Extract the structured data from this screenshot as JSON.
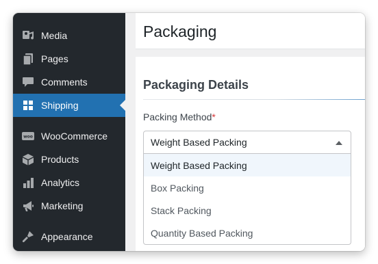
{
  "sidebar": {
    "items": [
      {
        "label": "Media",
        "icon": "media-icon",
        "active": false
      },
      {
        "label": "Pages",
        "icon": "pages-icon",
        "active": false
      },
      {
        "label": "Comments",
        "icon": "comments-icon",
        "active": false
      },
      {
        "label": "Shipping",
        "icon": "shipping-icon",
        "active": true
      },
      {
        "label": "WooCommerce",
        "icon": "woocommerce-icon",
        "active": false
      },
      {
        "label": "Products",
        "icon": "products-icon",
        "active": false
      },
      {
        "label": "Analytics",
        "icon": "analytics-icon",
        "active": false
      },
      {
        "label": "Marketing",
        "icon": "marketing-icon",
        "active": false
      },
      {
        "label": "Appearance",
        "icon": "appearance-icon",
        "active": false
      }
    ]
  },
  "page": {
    "title": "Packaging"
  },
  "details": {
    "section_title": "Packaging Details",
    "field_label": "Packing Method",
    "required_mark": "*",
    "selected_value": "Weight Based Packing",
    "options": [
      "Weight Based Packing",
      "Box Packing",
      "Stack Packing",
      "Quantity Based Packing"
    ],
    "highlighted_option_index": 0
  },
  "colors": {
    "sidebar_bg": "#23282d",
    "active_bg": "#2271b1",
    "required": "#d63638"
  }
}
